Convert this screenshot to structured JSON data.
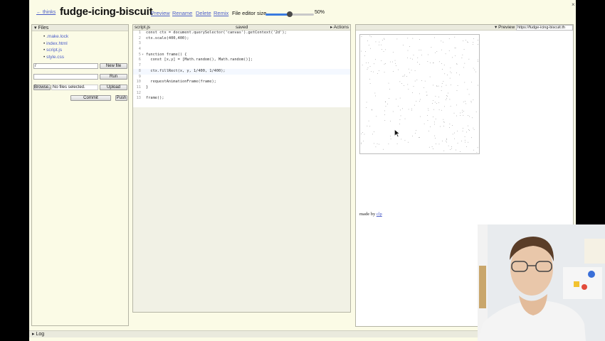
{
  "topbar": {
    "back_link": "← thinks",
    "title": "fudge-icing-biscuit",
    "nav": [
      "Preview",
      "Rename",
      "Delete",
      "Remix"
    ],
    "editor_size_label": "File editor size",
    "editor_size_value": "50%",
    "editor_size_fraction": 0.5,
    "close": "×"
  },
  "files": {
    "header": "▾ Files",
    "items": [
      ".make.lock",
      "index.html",
      "script.js",
      "style.css"
    ],
    "path_value": "/",
    "new_file_label": "New file",
    "run_label": "Run",
    "browse_label": "Browse...",
    "no_file_label": "No files selected.",
    "upload_label": "Upload",
    "commit_label": "Commit",
    "push_label": "Push"
  },
  "editor": {
    "filename": "script.js",
    "status": "saved",
    "actions": "▸ Actions",
    "lines": [
      {
        "n": "1",
        "fold": "",
        "text": "const ctx = document.querySelector('canvas').getContext('2d');"
      },
      {
        "n": "2",
        "fold": "",
        "text": "ctx.scale(400,400);"
      },
      {
        "n": "3",
        "fold": "",
        "text": ""
      },
      {
        "n": "4",
        "fold": "",
        "text": ""
      },
      {
        "n": "5",
        "fold": "▾",
        "text": "function frame() {"
      },
      {
        "n": "6",
        "fold": "",
        "text": "  const [x,y] = [Math.random(), Math.random()];"
      },
      {
        "n": "7",
        "fold": "",
        "text": ""
      },
      {
        "n": "8",
        "fold": "",
        "text": "  ctx.fillRect(x, y, 1/400, 1/400);"
      },
      {
        "n": "9",
        "fold": "",
        "text": ""
      },
      {
        "n": "10",
        "fold": "",
        "text": "  requestAnimationFrame(frame);"
      },
      {
        "n": "11",
        "fold": "",
        "text": "}"
      },
      {
        "n": "12",
        "fold": "",
        "text": ""
      },
      {
        "n": "13",
        "fold": "",
        "text": "frame();"
      }
    ]
  },
  "preview": {
    "header": "▾ Preview",
    "url": "https://fudge-icing-biscuit.th",
    "made_by_prefix": "made by ",
    "made_by_link": "clp"
  },
  "log": {
    "header": "▸ Log"
  }
}
